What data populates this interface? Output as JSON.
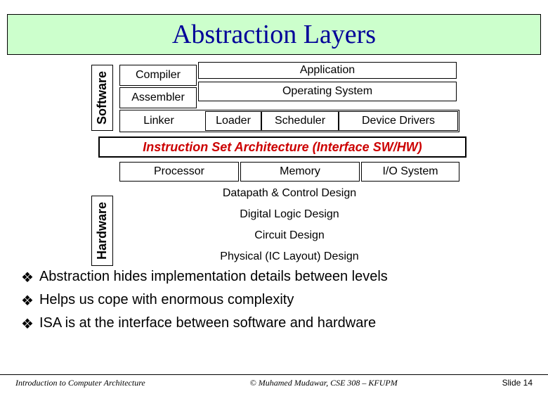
{
  "title": "Abstraction Layers",
  "labels": {
    "software": "Software",
    "hardware": "Hardware"
  },
  "sw": {
    "compiler": "Compiler",
    "application": "Application",
    "assembler": "Assembler",
    "os": "Operating System",
    "linker": "Linker",
    "loader": "Loader",
    "scheduler": "Scheduler",
    "device_drivers": "Device Drivers"
  },
  "isa": "Instruction Set Architecture (Interface SW/HW)",
  "hw": {
    "processor": "Processor",
    "memory": "Memory",
    "io": "I/O System",
    "datapath": "Datapath & Control Design",
    "digital": "Digital Logic Design",
    "circuit": "Circuit Design",
    "physical": "Physical (IC Layout) Design"
  },
  "bullets": [
    "Abstraction hides implementation details between levels",
    "Helps us cope with enormous complexity",
    "ISA is at the interface between software and hardware"
  ],
  "footer": {
    "left": "Introduction to Computer Architecture",
    "center": "© Muhamed Mudawar, CSE 308 – KFUPM",
    "right": "Slide 14"
  }
}
